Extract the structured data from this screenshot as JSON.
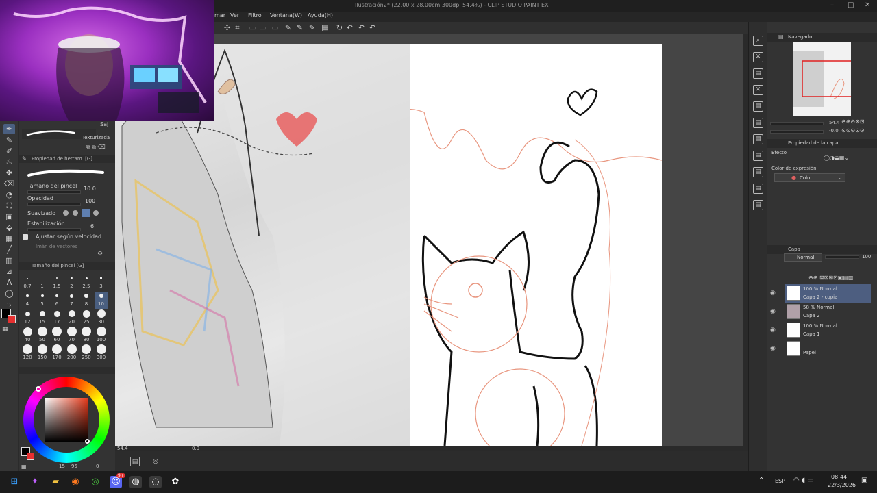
{
  "window": {
    "title": "Ilustración2* (22.00 x 28.00cm 300dpi 54.4%) - CLIP STUDIO PAINT EX",
    "controls": [
      "–",
      "□",
      "✕"
    ]
  },
  "menu": {
    "items": [
      {
        "label": "mar",
        "name": "menu-filtrar"
      },
      {
        "label": "Ver",
        "name": "menu-ver"
      },
      {
        "label": "Filtro",
        "name": "menu-filtro"
      },
      {
        "label": "Ventana(W)",
        "name": "menu-ventana"
      },
      {
        "label": "Ayuda(H)",
        "name": "menu-ayuda"
      }
    ]
  },
  "tool_property": {
    "sub_tool_label": "Saj",
    "brush_name": "Texturizada",
    "header": "Propiedad de herram. [G]",
    "size_label": "Tamaño del pincel",
    "size_value": "10.0",
    "opacity_label": "Opacidad",
    "opacity_value": "100",
    "smoothing_label": "Suavizado",
    "stabilization_label": "Estabilización",
    "stabilization_value": "6",
    "velocity_label": "Ajustar según velocidad",
    "vector_label": "Imán de vectores"
  },
  "brush_size": {
    "header": "Tamaño del pincel [G]",
    "sizes": [
      "0.7",
      "1",
      "1.5",
      "2",
      "2.5",
      "3",
      "4",
      "5",
      "6",
      "7",
      "8",
      "10",
      "12",
      "15",
      "17",
      "20",
      "25",
      "30",
      "40",
      "50",
      "60",
      "70",
      "80",
      "100",
      "120",
      "150",
      "170",
      "200",
      "250",
      "300"
    ],
    "selected": "10"
  },
  "color": {
    "main": "#000000",
    "sub": "#e63030",
    "readout_h": "15",
    "readout_s": "95",
    "readout_v": "0"
  },
  "navigator": {
    "header": "Navegador",
    "zoom": "54.4",
    "rotation": "-0.0"
  },
  "layer_property": {
    "header": "Propiedad de la capa",
    "effect_label": "Efecto",
    "expression_label": "Color de expresión",
    "expression_value": "Color"
  },
  "layers": {
    "header": "Capa",
    "blend_mode": "Normal",
    "opacity": "100",
    "items": [
      {
        "line1": "100 % Normal",
        "line2": "Capa 2 - copia",
        "selected": true
      },
      {
        "line1": "58 % Normal",
        "line2": "Capa 2",
        "selected": false
      },
      {
        "line1": "100 % Normal",
        "line2": "Capa 1",
        "selected": false
      },
      {
        "line1": "",
        "line2": "Papel",
        "selected": false
      }
    ]
  },
  "canvas_status": {
    "zoom": "54.4",
    "angle": "0.0"
  },
  "taskbar": {
    "lang": "ESP",
    "time": "08:44",
    "date": "22/3/2026",
    "discord_badge": "9+"
  }
}
